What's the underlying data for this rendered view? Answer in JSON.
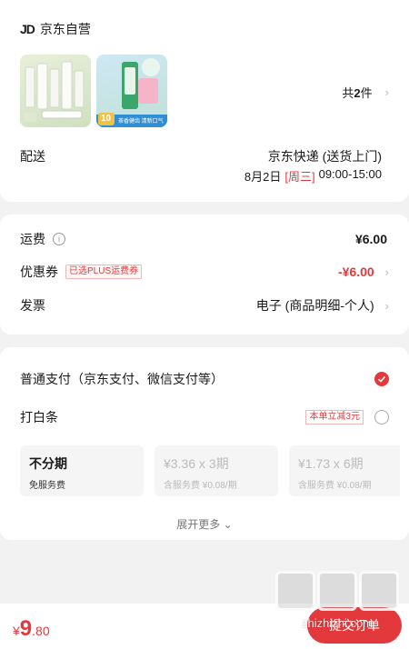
{
  "store": {
    "logo": "JD",
    "name": "京东自营",
    "item_count_prefix": "共",
    "item_count": "2",
    "item_count_suffix": "件"
  },
  "products": [
    {
      "label": "洗面奶套装",
      "image": "cleanser-bottles"
    },
    {
      "label": "牙膏",
      "badge": "10",
      "caption": "茶香健齿 清新口气"
    }
  ],
  "shipping": {
    "label": "配送",
    "method": "京东快递 (送货上门)",
    "date": "8月2日",
    "weekday": "[周三]",
    "time": "09:00-15:00"
  },
  "fees": {
    "freight_label": "运费",
    "freight_value": "¥6.00",
    "coupon_label": "优惠券",
    "coupon_tag": "已选PLUS运费券",
    "coupon_value": "-¥6.00",
    "invoice_label": "发票",
    "invoice_value": "电子 (商品明细-个人)"
  },
  "payment": {
    "normal_label": "普通支付（京东支付、微信支付等）",
    "baitiao_label": "打白条",
    "baitiao_discount": "本单立减3元",
    "plans": [
      {
        "main": "不分期",
        "sub": "免服务费"
      },
      {
        "main": "¥3.36 x 3期",
        "sub": "含服务费 ¥0.08/期"
      },
      {
        "main": "¥1.73 x 6期",
        "sub": "含服务费 ¥0.08/期"
      }
    ],
    "expand_label": "展开更多"
  },
  "bottom": {
    "currency": "¥",
    "total_int": "9",
    "total_dec": ".80",
    "submit_label": "提交订单"
  },
  "watermark": {
    "text": "zhizhizhi.com"
  },
  "colors": {
    "accent": "#e4393c",
    "background": "#f2f2f2"
  }
}
